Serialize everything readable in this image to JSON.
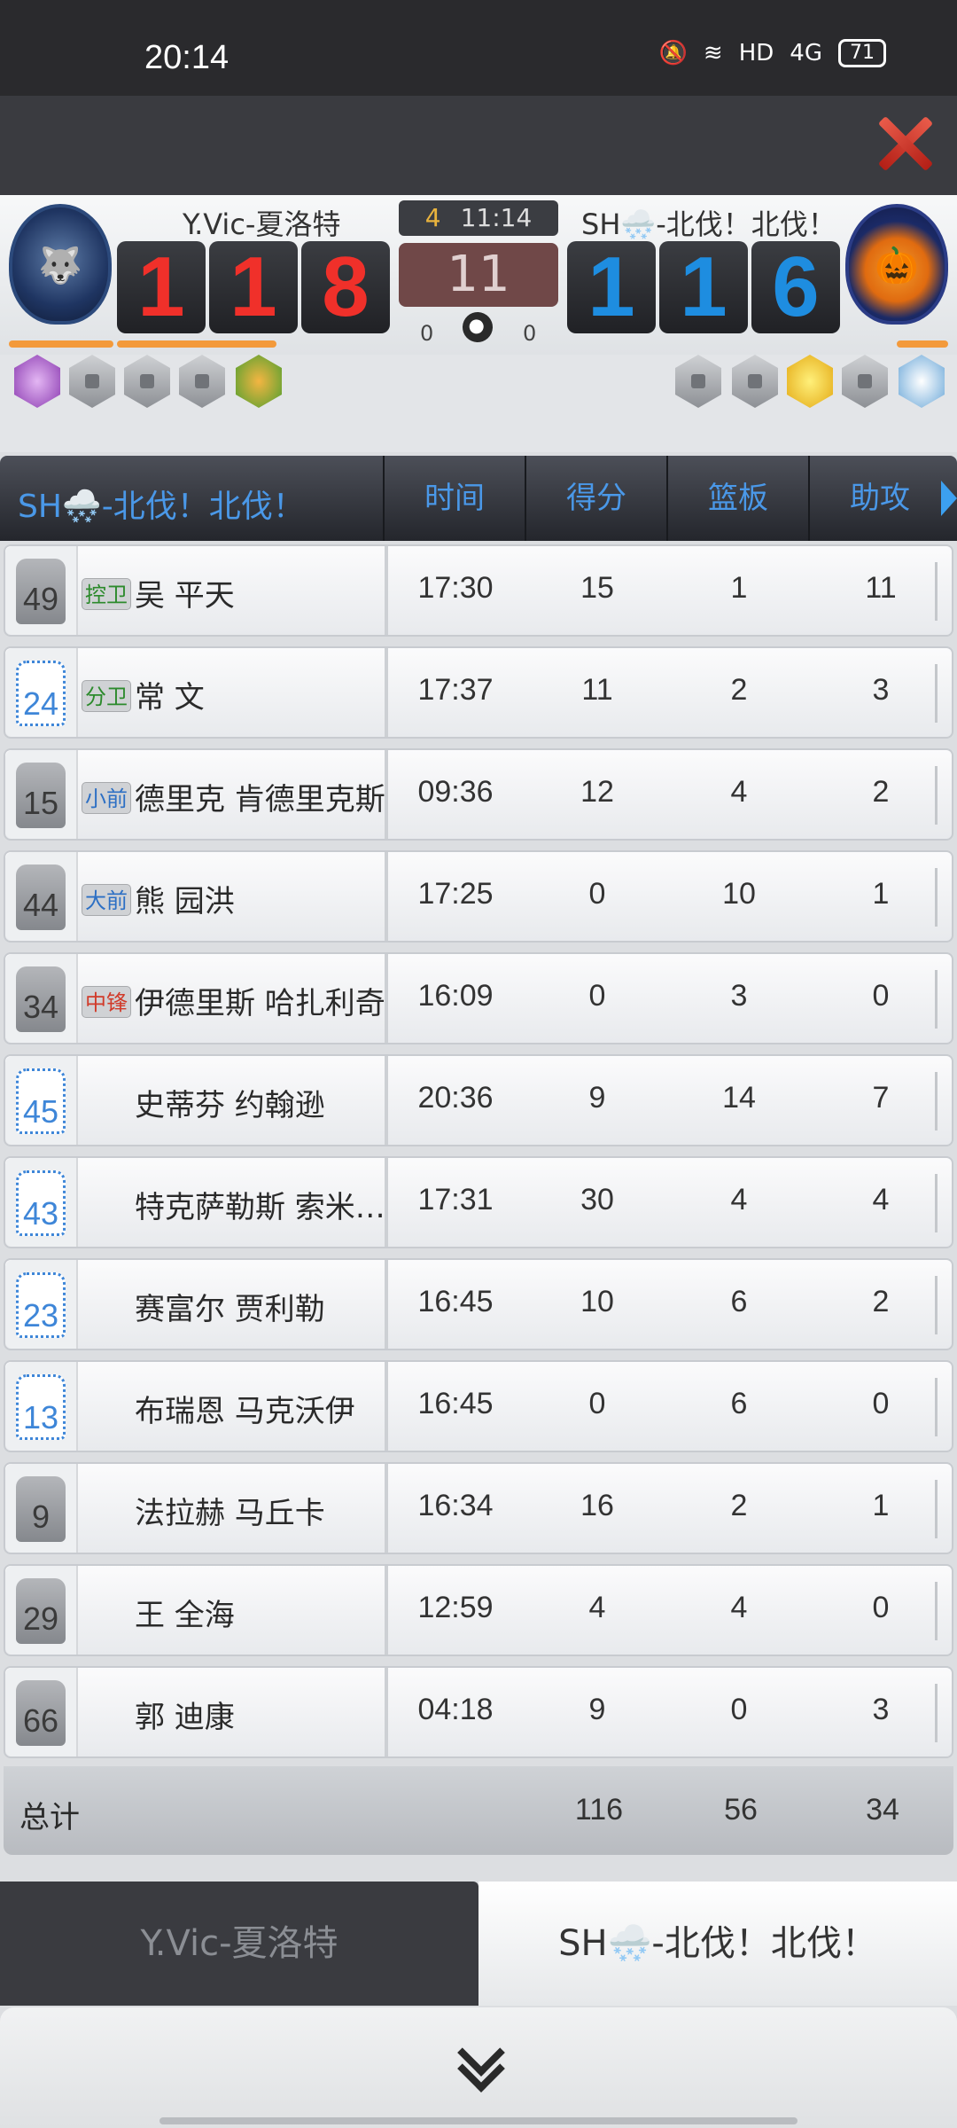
{
  "status_bar": {
    "time": "20:14",
    "network": "4G",
    "hd": "HD",
    "battery": "71"
  },
  "scoreboard": {
    "home": {
      "name": "Y.Vic-夏洛特",
      "score_digits": [
        "1",
        "1",
        "8"
      ],
      "fouls": "0",
      "color": "#f0302a"
    },
    "away": {
      "name": "SH🌨️-北伐！北伐！",
      "score_digits": [
        "1",
        "1",
        "6"
      ],
      "fouls": "0",
      "color": "#1e8de0"
    },
    "quarter": "4",
    "game_clock": "11:14",
    "shot_clock": "11"
  },
  "table": {
    "team_header": "SH🌨️-北伐！北伐！",
    "columns": [
      "时间",
      "得分",
      "篮板",
      "助攻"
    ],
    "rows": [
      {
        "number": "49",
        "jersey": "gray",
        "position": "控卫",
        "pos_color": "green",
        "name": "吴 平天",
        "time": "17:30",
        "points": "15",
        "rebounds": "1",
        "assists": "11"
      },
      {
        "number": "24",
        "jersey": "white",
        "position": "分卫",
        "pos_color": "green",
        "name": "常 文",
        "time": "17:37",
        "points": "11",
        "rebounds": "2",
        "assists": "3"
      },
      {
        "number": "15",
        "jersey": "gray",
        "position": "小前",
        "pos_color": "blue",
        "name": "德里克 肯德里克斯",
        "time": "09:36",
        "points": "12",
        "rebounds": "4",
        "assists": "2"
      },
      {
        "number": "44",
        "jersey": "gray",
        "position": "大前",
        "pos_color": "blue",
        "name": "熊 园洪",
        "time": "17:25",
        "points": "0",
        "rebounds": "10",
        "assists": "1"
      },
      {
        "number": "34",
        "jersey": "gray",
        "position": "中锋",
        "pos_color": "red",
        "name": "伊德里斯 哈扎利奇",
        "time": "16:09",
        "points": "0",
        "rebounds": "3",
        "assists": "0"
      },
      {
        "number": "45",
        "jersey": "white",
        "position": "",
        "pos_color": "",
        "name": "史蒂芬 约翰逊",
        "time": "20:36",
        "points": "9",
        "rebounds": "14",
        "assists": "7"
      },
      {
        "number": "43",
        "jersey": "white",
        "position": "",
        "pos_color": "",
        "name": "特克萨勒斯 索米…",
        "time": "17:31",
        "points": "30",
        "rebounds": "4",
        "assists": "4"
      },
      {
        "number": "23",
        "jersey": "white",
        "position": "",
        "pos_color": "",
        "name": "赛富尔 贾利勒",
        "time": "16:45",
        "points": "10",
        "rebounds": "6",
        "assists": "2"
      },
      {
        "number": "13",
        "jersey": "white",
        "position": "",
        "pos_color": "",
        "name": "布瑞恩 马克沃伊",
        "time": "16:45",
        "points": "0",
        "rebounds": "6",
        "assists": "0"
      },
      {
        "number": "9",
        "jersey": "gray",
        "position": "",
        "pos_color": "",
        "name": "法拉赫 马丘卡",
        "time": "16:34",
        "points": "16",
        "rebounds": "2",
        "assists": "1"
      },
      {
        "number": "29",
        "jersey": "gray",
        "position": "",
        "pos_color": "",
        "name": "王 全海",
        "time": "12:59",
        "points": "4",
        "rebounds": "4",
        "assists": "0"
      },
      {
        "number": "66",
        "jersey": "gray",
        "position": "",
        "pos_color": "",
        "name": "郭 迪康",
        "time": "04:18",
        "points": "9",
        "rebounds": "0",
        "assists": "3"
      }
    ],
    "total": {
      "label": "总计",
      "points": "116",
      "rebounds": "56",
      "assists": "34"
    }
  },
  "tabs": {
    "home": "Y.Vic-夏洛特",
    "away": "SH🌨️-北伐！北伐！"
  }
}
